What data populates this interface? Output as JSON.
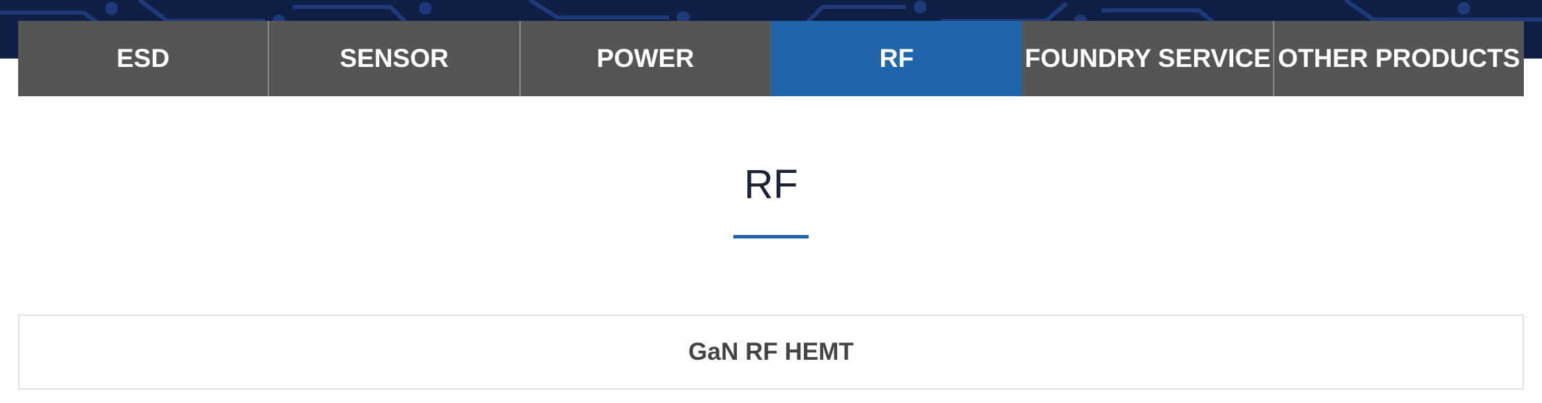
{
  "banner": {
    "background_color": "#0f1f45",
    "circuit_color": "#1f3a7a"
  },
  "nav": {
    "tabs": [
      {
        "label": "ESD",
        "active": false
      },
      {
        "label": "SENSOR",
        "active": false
      },
      {
        "label": "POWER",
        "active": false
      },
      {
        "label": "RF",
        "active": true
      },
      {
        "label": "FOUNDRY SERVICE",
        "active": false
      },
      {
        "label": "OTHER PRODUCTS",
        "active": false
      }
    ],
    "tab_color": "#555555",
    "active_color": "#2166ab"
  },
  "main": {
    "title": "RF",
    "accent_color": "#2166ab",
    "products": [
      {
        "label": "GaN RF HEMT"
      }
    ]
  }
}
